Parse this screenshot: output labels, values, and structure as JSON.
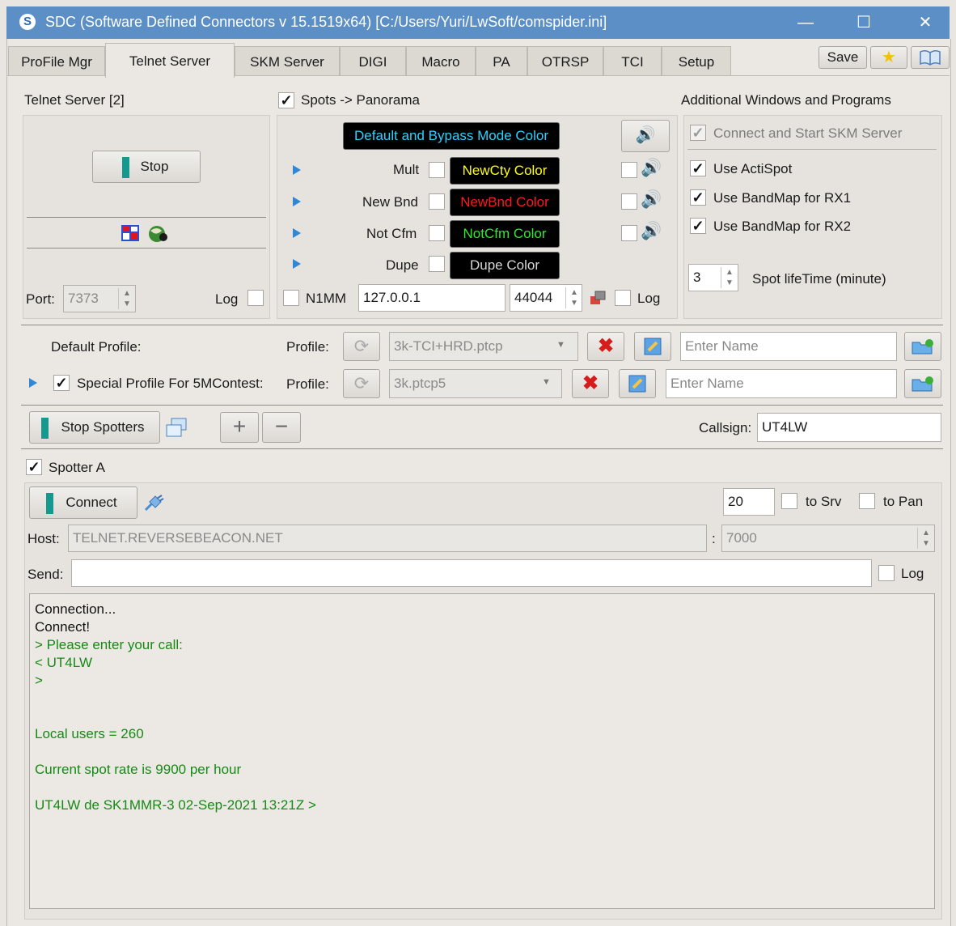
{
  "window": {
    "title": "SDC (Software Defined Connectors v 15.1519x64) [C:/Users/Yuri/LwSoft/comspider.ini]",
    "app_icon": "S",
    "minimize": "—",
    "maximize": "☐",
    "close": "✕"
  },
  "tabs": [
    "ProFile Mgr",
    "Telnet Server",
    "SKM Server",
    "DIGI",
    "Macro",
    "PA",
    "OTRSP",
    "TCI",
    "Setup"
  ],
  "toolbar": {
    "save_label": "Save"
  },
  "telnet_server": {
    "header": "Telnet Server [2]",
    "stop_label": "Stop",
    "port_label": "Port:",
    "port_value": "7373",
    "log_label": "Log"
  },
  "panorama": {
    "header": "Spots -> Panorama",
    "default_color_label": "Default and Bypass Mode Color",
    "rows": [
      {
        "label": "Mult",
        "color_label": "NewCty Color",
        "color": "#ffff00"
      },
      {
        "label": "New Bnd",
        "color_label": "NewBnd Color",
        "color": "#ff1a1a"
      },
      {
        "label": "Not Cfm",
        "color_label": "NotCfm Color",
        "color": "#2ee82e"
      },
      {
        "label": "Dupe",
        "color_label": "Dupe Color",
        "color": "#d8d8d8"
      }
    ],
    "n1mm_label": "N1MM",
    "n1mm_ip": "127.0.0.1",
    "n1mm_port": "44044",
    "log_label": "Log",
    "default_color": "#2fd0ff"
  },
  "additional": {
    "header": "Additional Windows and Programs",
    "connect_skm": "Connect and Start SKM Server",
    "use_actispot": "Use ActiSpot",
    "use_bandmap_rx1": "Use BandMap for RX1",
    "use_bandmap_rx2": "Use BandMap for RX2",
    "spot_lifetime_value": "3",
    "spot_lifetime_label": "Spot lifeTime (minute)"
  },
  "profiles": {
    "default_label": "Default Profile:",
    "profile_label": "Profile:",
    "default_profile": "3k-TCI+HRD.ptcp",
    "name_placeholder": "Enter Name",
    "special_label": "Special Profile For 5MContest:",
    "special_profile": "3k.ptcp5"
  },
  "spotters": {
    "stop_label": "Stop Spotters",
    "callsign_label": "Callsign:",
    "callsign_value": "UT4LW",
    "spotter_a_label": "Spotter A",
    "connect_label": "Connect",
    "count_value": "20",
    "to_srv_label": "to Srv",
    "to_pan_label": "to Pan",
    "host_label": "Host:",
    "host_value": "TELNET.REVERSEBEACON.NET",
    "host_sep": ":",
    "host_port": "7000",
    "send_label": "Send:",
    "send_value": "",
    "log_label": "Log"
  },
  "console": {
    "lines": [
      {
        "text": "Connection...",
        "color": "#111111"
      },
      {
        "text": "Connect!",
        "color": "#111111"
      },
      {
        "text": "> Please enter your call:",
        "color": "#158a15"
      },
      {
        "text": "< UT4LW",
        "color": "#158a15"
      },
      {
        "text": ">",
        "color": "#158a15"
      },
      {
        "text": "",
        "color": "#158a15"
      },
      {
        "text": "",
        "color": "#158a15"
      },
      {
        "text": "Local users =  260",
        "color": "#158a15"
      },
      {
        "text": "",
        "color": "#158a15"
      },
      {
        "text": "Current spot rate is 9900 per hour",
        "color": "#158a15"
      },
      {
        "text": "",
        "color": "#158a15"
      },
      {
        "text": "UT4LW de SK1MMR-3  02-Sep-2021 13:21Z >",
        "color": "#158a15"
      }
    ]
  },
  "colors": {
    "titlebar": "#5b8fc6",
    "accent_green": "#15998e",
    "console_green": "#158a15"
  }
}
